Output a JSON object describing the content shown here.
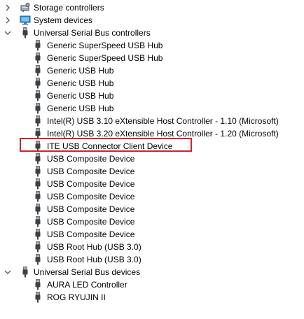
{
  "tree": {
    "categories": [
      {
        "label": "Storage controllers",
        "icon": "storage-controller-icon",
        "expanded": false
      },
      {
        "label": "System devices",
        "icon": "system-devices-icon",
        "expanded": false
      },
      {
        "label": "Universal Serial Bus controllers",
        "icon": "usb-plug-icon",
        "expanded": true,
        "children": [
          "Generic SuperSpeed USB Hub",
          "Generic SuperSpeed USB Hub",
          "Generic USB Hub",
          "Generic USB Hub",
          "Generic USB Hub",
          "Generic USB Hub",
          "Intel(R) USB 3.10 eXtensible Host Controller - 1.10 (Microsoft)",
          "Intel(R) USB 3.20 eXtensible Host Controller - 1.20 (Microsoft)",
          "ITE USB Connector Client Device",
          "USB Composite Device",
          "USB Composite Device",
          "USB Composite Device",
          "USB Composite Device",
          "USB Composite Device",
          "USB Composite Device",
          "USB Composite Device",
          "USB Root Hub (USB 3.0)",
          "USB Root Hub (USB 3.0)"
        ]
      },
      {
        "label": "Universal Serial Bus devices",
        "icon": "usb-plug-icon",
        "expanded": true,
        "children": [
          "AURA LED Controller",
          "ROG RYUJIN II"
        ]
      }
    ]
  },
  "highlight": {
    "target": "ITE USB Connector Client Device",
    "color": "#d0232a"
  },
  "colors": {
    "text": "#000000",
    "chevron": "#555555",
    "background": "#ffffff"
  }
}
